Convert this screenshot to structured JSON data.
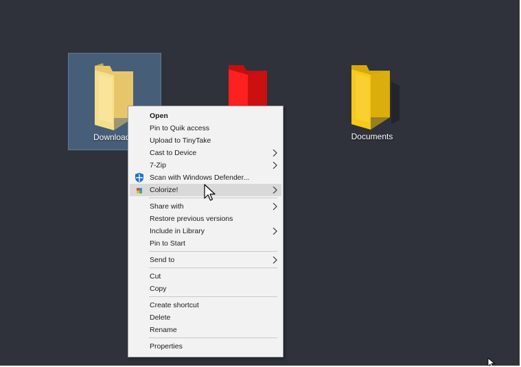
{
  "desktop": {
    "folders": [
      {
        "label": "Downloads",
        "color": "#f4d97a",
        "selected": true
      },
      {
        "label": "",
        "color": "#ff1a1a",
        "selected": false
      },
      {
        "label": "Documents",
        "color": "#f7c918",
        "selected": false
      }
    ]
  },
  "context_menu": {
    "items": [
      {
        "label": "Open",
        "bold": true
      },
      {
        "label": "Pin to Quik access"
      },
      {
        "label": "Upload to TinyTake"
      },
      {
        "label": "Cast to Device",
        "submenu": true
      },
      {
        "label": "7-Zip",
        "submenu": true
      },
      {
        "label": "Scan with Windows Defender...",
        "icon": "windows-defender-icon"
      },
      {
        "label": "Colorize!",
        "submenu": true,
        "icon": "colorize-icon",
        "hover": true
      },
      {
        "label": "Share with",
        "submenu": true
      },
      {
        "label": "Restore previous versions"
      },
      {
        "label": "Include in Library",
        "submenu": true
      },
      {
        "label": "Pin to Start"
      },
      {
        "label": "Send to",
        "submenu": true
      },
      {
        "label": "Cut"
      },
      {
        "label": "Copy"
      },
      {
        "label": "Create shortcut"
      },
      {
        "label": "Delete"
      },
      {
        "label": "Rename"
      },
      {
        "label": "Properties"
      }
    ]
  },
  "colors": {
    "desktop_background": "#2f323a",
    "selection_background": "#465e78",
    "menu_background": "#f2f2f2",
    "menu_hover": "#d9d9d9"
  }
}
